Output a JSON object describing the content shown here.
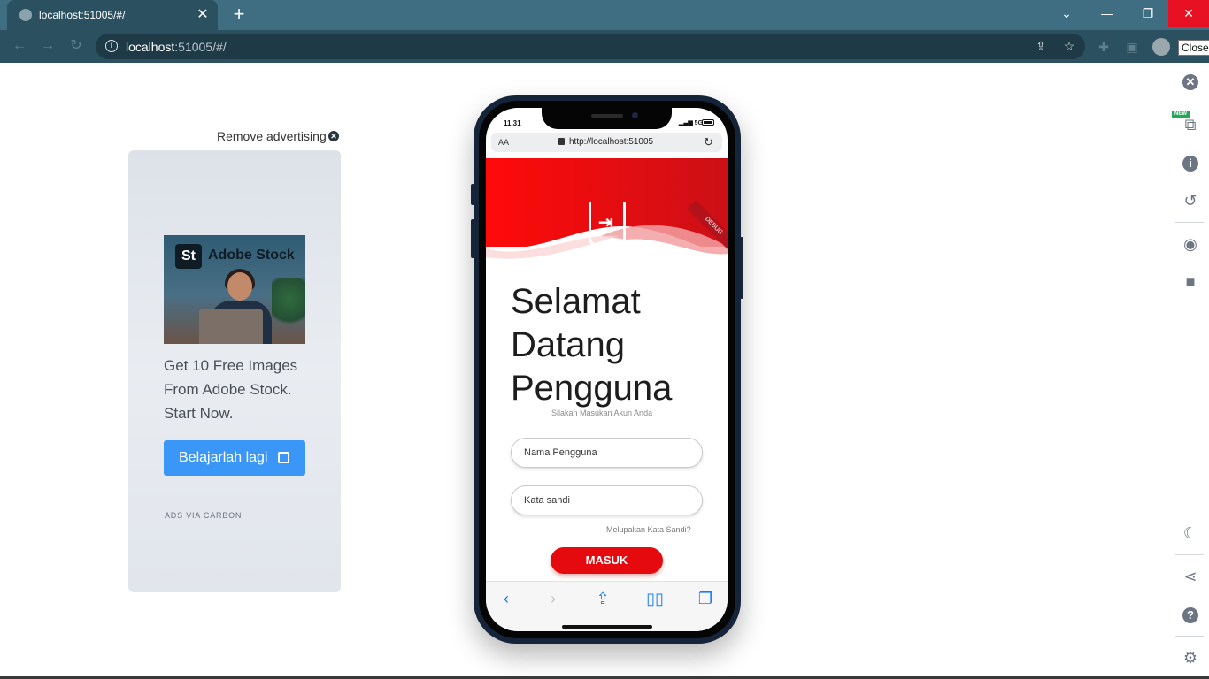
{
  "browser": {
    "tab_title": "localhost:51005/#/",
    "url_host": "localhost",
    "url_rest": ":51005/#/",
    "tooltip": "Close",
    "icons": [
      "globe-icon",
      "close-icon",
      "plus-icon",
      "chevron-down-icon",
      "minimize-icon",
      "restore-icon",
      "window-close-icon",
      "back-icon",
      "forward-icon",
      "reload-icon",
      "info-icon",
      "share-icon",
      "star-icon",
      "puzzle-icon",
      "sidepanel-icon",
      "profile-icon"
    ]
  },
  "ad": {
    "remove_label": "Remove advertising",
    "logo_text": "St",
    "brand_text": "Adobe Stock",
    "description": "Get 10 Free Images From Adobe Stock. Start Now.",
    "button_label": "Belajarlah lagi",
    "footer": "ADS VIA CARBON"
  },
  "phone": {
    "status_time": "11.31",
    "status_net": "5G",
    "addr_aa": "AA",
    "addr_url": "http://localhost:51005",
    "debug_banner": "DEBUG",
    "headline_1": "Selamat",
    "headline_2": "Datang",
    "headline_3": "Pengguna",
    "subtitle": "Silakan Masukan Akun Anda",
    "username_placeholder": "Nama Pengguna",
    "password_placeholder": "Kata sandi",
    "forgot": "Melupakan Kata Sandi?",
    "login_button": "MASUK",
    "colors": {
      "primary": "#e50a0e",
      "accent": "#1b7bf6"
    }
  },
  "right_panel": {
    "new_badge": "NEW",
    "icons": [
      "close-circle-icon",
      "devices-icon",
      "info-icon",
      "rotate-icon",
      "camera-icon",
      "video-icon",
      "moon-icon",
      "share-icon",
      "help-icon",
      "settings-icon"
    ]
  }
}
